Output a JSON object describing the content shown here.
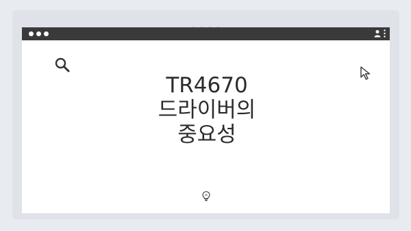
{
  "window": {
    "controls": [
      "close",
      "minimize",
      "maximize"
    ],
    "icons": [
      "user-icon",
      "more-vertical-icon"
    ]
  },
  "content": {
    "title_lines": [
      "TR4670",
      "드라이버의",
      "중요성"
    ],
    "icons": [
      "search-icon",
      "cursor-arrow-icon",
      "lightbulb-icon"
    ]
  },
  "colors": {
    "background": "#e8ebef",
    "frame": "#dfe3e9",
    "titlebar": "#3a3a3a",
    "window": "#ffffff",
    "text": "#2b2b2b",
    "icon_stroke": "#333333"
  }
}
